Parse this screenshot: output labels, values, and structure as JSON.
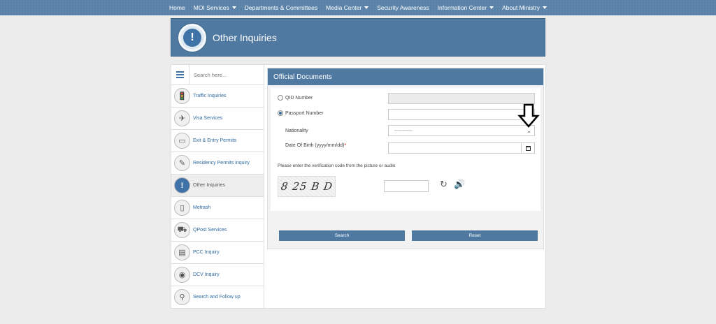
{
  "nav": {
    "items": [
      {
        "label": "Home",
        "dropdown": false
      },
      {
        "label": "MOI Services",
        "dropdown": true
      },
      {
        "label": "Departments & Committees",
        "dropdown": false
      },
      {
        "label": "Media Center",
        "dropdown": true
      },
      {
        "label": "Security Awareness",
        "dropdown": false
      },
      {
        "label": "Information Center",
        "dropdown": true
      },
      {
        "label": "About Ministry",
        "dropdown": true
      }
    ]
  },
  "banner": {
    "title": "Other Inquiries",
    "icon": "exclamation-icon"
  },
  "sidebar": {
    "search_placeholder": "Search here...",
    "items": [
      {
        "label": "Traffic Inquiries",
        "icon": "traffic-light-icon",
        "glyph": "🚦",
        "active": false
      },
      {
        "label": "Visa Services",
        "icon": "visa-icon",
        "glyph": "✈",
        "active": false
      },
      {
        "label": "Exit & Entry Permits",
        "icon": "passport-icon",
        "glyph": "▭",
        "active": false
      },
      {
        "label": "Residency Permits inquiry",
        "icon": "id-card-icon",
        "glyph": "✎",
        "active": false
      },
      {
        "label": "Other Inquiries",
        "icon": "exclamation-icon",
        "glyph": "!",
        "active": true
      },
      {
        "label": "Metrash",
        "icon": "phone-icon",
        "glyph": "▯",
        "active": false
      },
      {
        "label": "QPost Services",
        "icon": "truck-icon",
        "glyph": "⛟",
        "active": false
      },
      {
        "label": "PCC Inquiry",
        "icon": "certificate-icon",
        "glyph": "▤",
        "active": false
      },
      {
        "label": "DCV Inquiry",
        "icon": "fingerprint-icon",
        "glyph": "◉",
        "active": false
      },
      {
        "label": "Search and Follow up",
        "icon": "search-person-icon",
        "glyph": "⚲",
        "active": false
      }
    ]
  },
  "form": {
    "title": "Official Documents",
    "qid_label": "QID Number",
    "passport_label": "Passport Number",
    "selected_option": "passport",
    "nationality_label": "Nationality",
    "nationality_value": "-----------",
    "dob_label": "Date Of Birth (yyyy/mm/dd)",
    "dob_required": "*",
    "verification_note": "Please enter the verification code from the picture or audio",
    "captcha_text": "8 25 B D",
    "search_label": "Search",
    "reset_label": "Reset"
  }
}
